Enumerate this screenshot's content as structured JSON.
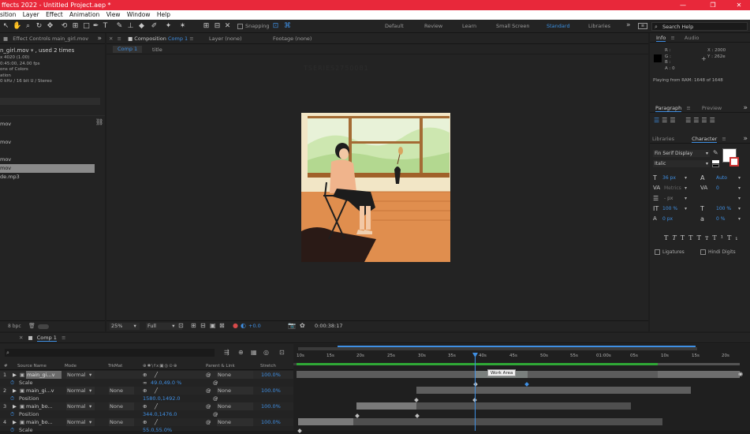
{
  "titlebar": {
    "title": "ffects 2022 - Untitled Project.aep *"
  },
  "window_controls": {
    "minimize": "—",
    "maximize": "❐",
    "close": "✕"
  },
  "menu": [
    "sition",
    "Layer",
    "Effect",
    "Animation",
    "View",
    "Window",
    "Help"
  ],
  "toolbar": {
    "snapping_label": "Snapping",
    "workspaces": [
      "Default",
      "Review",
      "Learn",
      "Small Screen",
      "Standard",
      "Libraries"
    ],
    "active_workspace": "Standard",
    "search_placeholder": "Search Help"
  },
  "left_panel": {
    "tab": "Effect Controls main_girl.mov",
    "file_name": "n_girl.mov",
    "used": ", used 2 times",
    "info_lines": [
      "x 4020 (1.00)",
      "0:45:00, 24.00 fps",
      "ons of Colors",
      "ation",
      "0 kHz / 16 bit U / Stereo"
    ],
    "items": [
      "mov",
      "mov",
      "mov",
      "mov",
      "de.mp3"
    ],
    "selected_index": 3,
    "bpc": "8 bpc"
  },
  "comp_panel": {
    "tab_prefix": "Composition",
    "tab_name": "Comp 1",
    "layer_tab": "Layer (none)",
    "footage_tab": "Footage (none)",
    "breadcrumb_comp": "Comp 1",
    "breadcrumb_title": "title",
    "watermark": "TSERIES2750081",
    "zoom": "25%",
    "resolution": "Full",
    "exposure": "+0.0",
    "timecode": "0:00:38:17"
  },
  "info_panel": {
    "tab_info": "Info",
    "tab_audio": "Audio",
    "r": "R :",
    "g": "G :",
    "b": "B :",
    "a": "A : 0",
    "x": "X : 2000",
    "y": "Y : 262e",
    "playing": "Playing from RAM: 1648 of 1648"
  },
  "paragraph_panel": {
    "tab": "Paragraph",
    "preview": "Preview"
  },
  "character_panel": {
    "libraries": "Libraries",
    "tab": "Character",
    "font": "Fin Serif Display",
    "style": "Italic",
    "size": "36 px",
    "leading": "Auto",
    "kerning": "Metrics",
    "tracking": "0",
    "stroke": "- px",
    "vscale": "100 %",
    "hscale": "100 %",
    "baseline": "0 px",
    "tsume": "0 %",
    "ligatures": "Ligatures",
    "hindi": "Hindi Digits"
  },
  "timeline": {
    "tab": "Comp 1",
    "headers": {
      "source": "Source Name",
      "mode": "Mode",
      "trkmat": "TrkMat",
      "parent": "Parent & Link",
      "stretch": "Stretch"
    },
    "ruler": [
      "10s",
      "15s",
      "20s",
      "25s",
      "30s",
      "35s",
      "40s",
      "45s",
      "50s",
      "55s",
      "01:00s",
      "05s",
      "10s",
      "15s",
      "20s"
    ],
    "work_area_tooltip": "Work Area",
    "layers": [
      {
        "num": "1",
        "name": "main_gi...v",
        "mode": "Normal",
        "trkmat": "",
        "parent": "None",
        "stretch": "100.0%",
        "prop": "Scale",
        "prop_value": "49.0,49.0 %"
      },
      {
        "num": "2",
        "name": "main_gi...v",
        "mode": "Normal",
        "trkmat": "None",
        "parent": "None",
        "stretch": "100.0%",
        "prop": "Position",
        "prop_value": "1580.0,1492.0"
      },
      {
        "num": "3",
        "name": "main_bo...",
        "mode": "Normal",
        "trkmat": "None",
        "parent": "None",
        "stretch": "100.0%",
        "prop": "Position",
        "prop_value": "344.0,1476.0"
      },
      {
        "num": "4",
        "name": "main_bo...",
        "mode": "Normal",
        "trkmat": "None",
        "parent": "None",
        "stretch": "100.0%",
        "prop": "Scale",
        "prop_value": "55.0,55.0%"
      }
    ]
  },
  "colors": {
    "accent": "#3f8fe3",
    "titlebar": "#e8283a",
    "playhead": "#3f8fe3"
  }
}
